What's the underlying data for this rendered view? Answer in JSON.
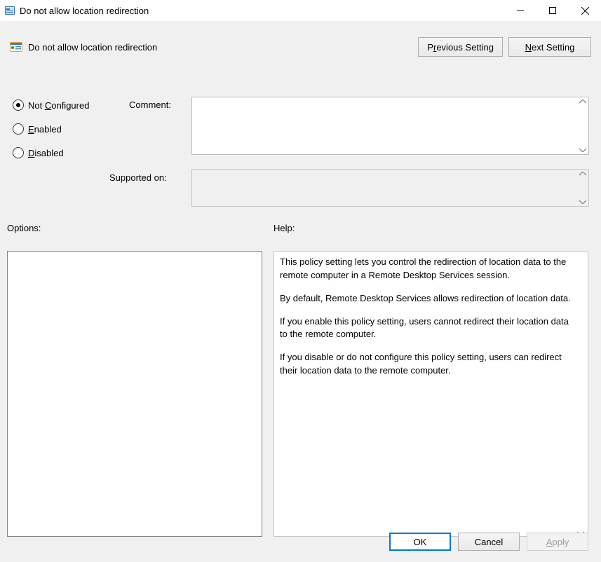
{
  "window": {
    "title": "Do not allow location redirection"
  },
  "header": {
    "setting_name": "Do not allow location redirection",
    "prev_label_pre": "P",
    "prev_label_mn": "r",
    "prev_label_post": "evious Setting",
    "next_label_mn": "N",
    "next_label_post": "ext Setting"
  },
  "state": {
    "not_configured_pre": "Not ",
    "not_configured_mn": "C",
    "not_configured_post": "onfigured",
    "enabled_mn": "E",
    "enabled_post": "nabled",
    "disabled_mn": "D",
    "disabled_post": "isabled",
    "selected": "not_configured"
  },
  "meta": {
    "comment_label": "Comment:",
    "comment_value": "",
    "supported_label": "Supported on:",
    "supported_value": ""
  },
  "sections": {
    "options_label": "Options:",
    "help_label": "Help:"
  },
  "help": {
    "p1": "This policy setting lets you control the redirection of location data to the remote computer in a Remote Desktop Services session.",
    "p2": "By default, Remote Desktop Services allows redirection of location data.",
    "p3": "If you enable this policy setting, users cannot redirect their location data to the remote computer.",
    "p4": "If you disable or do not configure this policy setting, users can redirect their location data to the remote computer."
  },
  "buttons": {
    "ok": "OK",
    "cancel": "Cancel",
    "apply_mn": "A",
    "apply_post": "pply"
  }
}
